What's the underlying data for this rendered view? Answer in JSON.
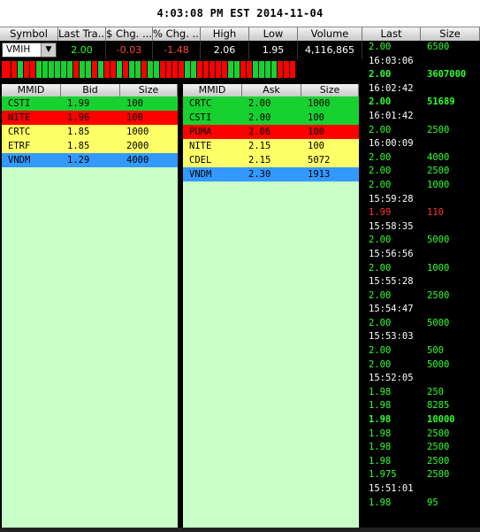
{
  "clock": "4:03:08 PM EST 2014-11-04",
  "quote": {
    "headers": [
      "Symbol",
      "Last Tra...",
      "$ Chg. ...",
      "% Chg. ...",
      "High",
      "Low",
      "Volume"
    ],
    "symbol": "VMIH",
    "last": "2.00",
    "chg": "-0.03",
    "pct_chg": "-1.48",
    "high": "2.06",
    "low": "1.95",
    "volume": "4,116,865"
  },
  "tick_colors": [
    "red",
    "red",
    "green",
    "red",
    "red",
    "green",
    "green",
    "green",
    "green",
    "green",
    "green",
    "red",
    "green",
    "green",
    "red",
    "green",
    "red",
    "red",
    "green",
    "red",
    "green",
    "green",
    "red",
    "green",
    "green",
    "red",
    "red",
    "red",
    "red",
    "green",
    "green",
    "red",
    "red",
    "red",
    "red",
    "red",
    "green",
    "green",
    "red",
    "red",
    "green",
    "green",
    "green",
    "green",
    "red",
    "red",
    "red"
  ],
  "colors": {
    "green": "#17d130",
    "red": "#ff0000",
    "yellow": "#ffff66",
    "blue": "#3399ff",
    "light_green": "#c8ffc8"
  },
  "bid_book": {
    "headers": [
      "MMID",
      "Bid",
      "Size"
    ],
    "rows": [
      {
        "mmid": "CSTI",
        "price": "1.99",
        "size": "100",
        "color": "green"
      },
      {
        "mmid": "NITE",
        "price": "1.96",
        "size": "100",
        "color": "red"
      },
      {
        "mmid": "CRTC",
        "price": "1.85",
        "size": "1000",
        "color": "yellow"
      },
      {
        "mmid": "ETRF",
        "price": "1.85",
        "size": "2000",
        "color": "yellow"
      },
      {
        "mmid": "VNDM",
        "price": "1.29",
        "size": "4000",
        "color": "blue"
      }
    ]
  },
  "ask_book": {
    "headers": [
      "MMID",
      "Ask",
      "Size"
    ],
    "rows": [
      {
        "mmid": "CRTC",
        "price": "2.00",
        "size": "1000",
        "color": "green"
      },
      {
        "mmid": "CSTI",
        "price": "2.00",
        "size": "100",
        "color": "green"
      },
      {
        "mmid": "PUMA",
        "price": "2.06",
        "size": "100",
        "color": "red"
      },
      {
        "mmid": "NITE",
        "price": "2.15",
        "size": "100",
        "color": "yellow"
      },
      {
        "mmid": "CDEL",
        "price": "2.15",
        "size": "5072",
        "color": "yellow"
      },
      {
        "mmid": "VNDM",
        "price": "2.30",
        "size": "1913",
        "color": "blue"
      }
    ]
  },
  "time_sales": {
    "headers": [
      "Last",
      "Size"
    ],
    "rows": [
      {
        "last": "2.00",
        "size": "6500",
        "type": "trade"
      },
      {
        "last": "16:03:06",
        "type": "time"
      },
      {
        "last": "2.00",
        "size": "3607000",
        "type": "trade",
        "bold": true
      },
      {
        "last": "16:02:42",
        "type": "time"
      },
      {
        "last": "2.00",
        "size": "51689",
        "type": "trade",
        "bold": true
      },
      {
        "last": "16:01:42",
        "type": "time"
      },
      {
        "last": "2.00",
        "size": "2500",
        "type": "trade"
      },
      {
        "last": "16:00:09",
        "type": "time"
      },
      {
        "last": "2.00",
        "size": "4000",
        "type": "trade"
      },
      {
        "last": "2.00",
        "size": "2500",
        "type": "trade"
      },
      {
        "last": "2.00",
        "size": "1000",
        "type": "trade"
      },
      {
        "last": "15:59:28",
        "type": "time"
      },
      {
        "last": "1.99",
        "size": "110",
        "type": "trade",
        "down": true
      },
      {
        "last": "15:58:35",
        "type": "time"
      },
      {
        "last": "2.00",
        "size": "5000",
        "type": "trade"
      },
      {
        "last": "15:56:56",
        "type": "time"
      },
      {
        "last": "2.00",
        "size": "1000",
        "type": "trade"
      },
      {
        "last": "15:55:28",
        "type": "time"
      },
      {
        "last": "2.00",
        "size": "2500",
        "type": "trade"
      },
      {
        "last": "15:54:47",
        "type": "time"
      },
      {
        "last": "2.00",
        "size": "5000",
        "type": "trade"
      },
      {
        "last": "15:53:03",
        "type": "time"
      },
      {
        "last": "2.00",
        "size": "500",
        "type": "trade"
      },
      {
        "last": "2.00",
        "size": "5000",
        "type": "trade"
      },
      {
        "last": "15:52:05",
        "type": "time"
      },
      {
        "last": "1.98",
        "size": "250",
        "type": "trade"
      },
      {
        "last": "1.98",
        "size": "8285",
        "type": "trade"
      },
      {
        "last": "1.98",
        "size": "10000",
        "type": "trade",
        "bold": true
      },
      {
        "last": "1.98",
        "size": "2500",
        "type": "trade"
      },
      {
        "last": "1.98",
        "size": "2500",
        "type": "trade"
      },
      {
        "last": "1.98",
        "size": "2500",
        "type": "trade"
      },
      {
        "last": "1.975",
        "size": "2500",
        "type": "trade"
      },
      {
        "last": "15:51:01",
        "type": "time"
      },
      {
        "last": "1.98",
        "size": "95",
        "type": "trade"
      }
    ]
  }
}
